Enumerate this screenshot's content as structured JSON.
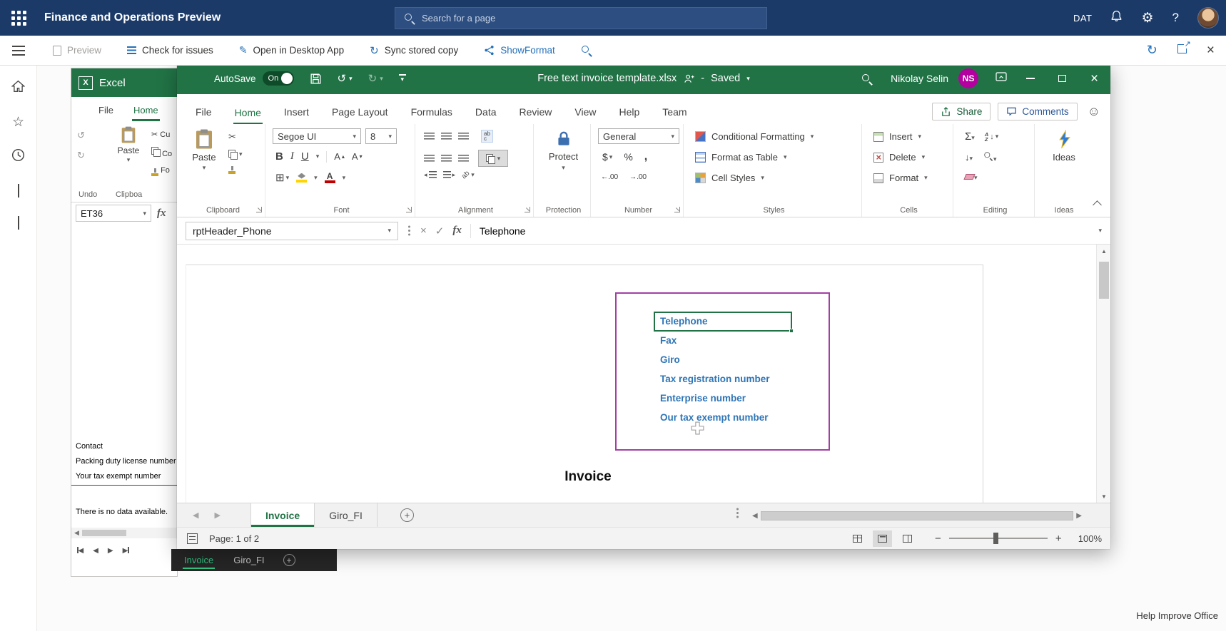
{
  "colors": {
    "navy": "#1B3A68",
    "excel_green": "#217346",
    "link_blue": "#2470B8",
    "field_label_blue": "#2E75B6",
    "range_border_purple": "#A33FA3",
    "avatar_magenta": "#B4009E"
  },
  "topnav": {
    "app_title": "Finance and Operations Preview",
    "search_placeholder": "Search for a page",
    "environment": "DAT"
  },
  "commandbar": {
    "preview": "Preview",
    "check_for_issues": "Check for issues",
    "open_in_desktop_app": "Open in Desktop App",
    "sync_stored_copy": "Sync stored copy",
    "show_format": "ShowFormat"
  },
  "bg_excel": {
    "app_name": "Excel",
    "tabs": {
      "file": "File",
      "home": "Home"
    },
    "ribbon": {
      "paste": "Paste",
      "cut": "Cu",
      "copy": "Co",
      "format_painter": "Fo",
      "undo_group": "Undo",
      "clipboard_group": "Clipboa"
    },
    "name_box": "ET36",
    "fx": "fx",
    "cells": [
      "Contact",
      "Packing duty license number",
      "Your tax exempt number"
    ],
    "empty_message": "There is no data available.",
    "sheet_tabs": [
      "Invoice",
      "Giro_FI"
    ]
  },
  "excel": {
    "titlebar": {
      "autosave_label": "AutoSave",
      "autosave_state": "On",
      "filename": "Free text invoice template.xlsx",
      "separator": "-",
      "save_status": "Saved",
      "user_name": "Nikolay Selin",
      "user_initials": "NS"
    },
    "tabs": [
      "File",
      "Home",
      "Insert",
      "Page Layout",
      "Formulas",
      "Data",
      "Review",
      "View",
      "Help",
      "Team"
    ],
    "share_label": "Share",
    "comments_label": "Comments",
    "ribbon": {
      "paste_label": "Paste",
      "font_name": "Segoe UI",
      "font_size": "8",
      "protect_label": "Protect",
      "number_format": "General",
      "conditional_formatting": "Conditional Formatting",
      "format_as_table": "Format as Table",
      "cell_styles": "Cell Styles",
      "insert": "Insert",
      "delete": "Delete",
      "format": "Format",
      "ideas_label": "Ideas",
      "groups": {
        "clipboard": "Clipboard",
        "font": "Font",
        "alignment": "Alignment",
        "protection": "Protection",
        "number": "Number",
        "styles": "Styles",
        "cells": "Cells",
        "editing": "Editing",
        "ideas": "Ideas"
      }
    },
    "formula_bar": {
      "name_box": "rptHeader_Phone",
      "fx": "fx",
      "formula": "Telephone"
    },
    "sheet": {
      "fields": [
        "Telephone",
        "Fax",
        "Giro",
        "Tax registration number",
        "Enterprise number",
        "Our tax exempt number"
      ],
      "doc_title": "Invoice"
    },
    "sheet_tabs": [
      "Invoice",
      "Giro_FI"
    ],
    "status_bar": {
      "page_info": "Page: 1 of 2",
      "zoom_level": "100%"
    }
  },
  "footer": {
    "help_text": "Help Improve Office"
  }
}
